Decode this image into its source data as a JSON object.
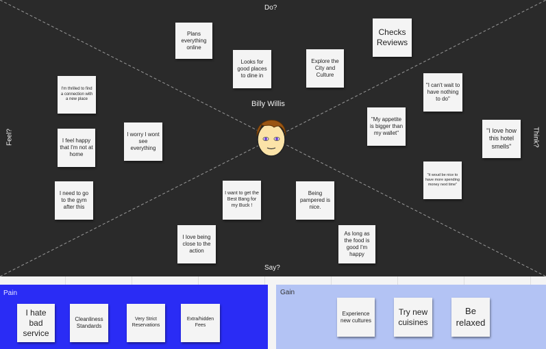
{
  "axes": {
    "top": "Do?",
    "bottom": "Say?",
    "left": "Feel?",
    "right": "Think?"
  },
  "persona": {
    "name": "Billy Willis",
    "avatar_icon": "boy-face-icon"
  },
  "colors": {
    "board": "#2a2a2a",
    "note": "#f4f4f4",
    "pain": "#2a2cf5",
    "gain": "#b3c3f4"
  },
  "do_notes": [
    "Plans everything online",
    "Looks for good places to dine in",
    "Explore the City and Culture",
    "Checks Reviews"
  ],
  "feel_notes": [
    "I'm thrilled to find a connection with a new place",
    "I worry I wont see everything",
    "I feel happy that I'm not at home",
    "I need to go to the gym after this"
  ],
  "think_notes": [
    "\"I can't wait to have nothing to do\"",
    "\"My appetite is bigger than my wallet\"",
    "\"I love how this hotel smells\"",
    "\"it woud be nice to have more spending money next time\""
  ],
  "say_notes": [
    "I want to get the Best Bang for my Buck !",
    "Being pampered is nice.",
    "I love being close to the action",
    "As long as the food is good I'm happy"
  ],
  "pain": {
    "title": "Pain",
    "notes": [
      "I hate bad service",
      "Cleanliness Standards",
      "Very Strict Reservations",
      "Extra/hidden Fees"
    ]
  },
  "gain": {
    "title": "Gain",
    "notes": [
      "Experience new cultures",
      "Try new cuisines",
      "Be relaxed"
    ]
  }
}
